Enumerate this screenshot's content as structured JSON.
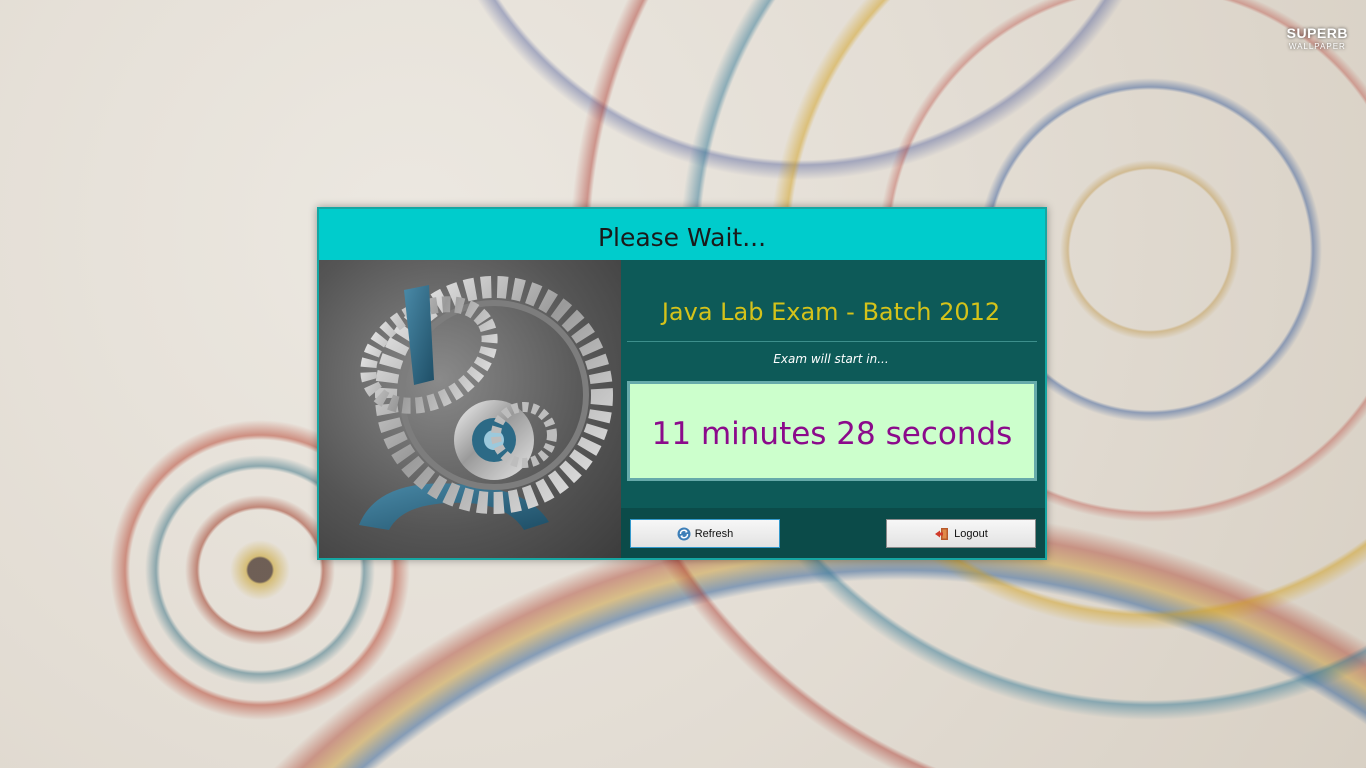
{
  "wallpaper": {
    "watermark_main": "SUPERB",
    "watermark_sub": "WALLPAPER"
  },
  "dialog": {
    "title": "Please Wait...",
    "exam_title": "Java Lab Exam - Batch 2012",
    "start_label": "Exam will start in...",
    "countdown": "11 minutes 28 seconds",
    "refresh_label": "Refresh",
    "logout_label": "Logout",
    "colors": {
      "header": "#00cccc",
      "body": "#0d5a58",
      "title_text": "#d4c21a",
      "countdown_bg": "#ccffcc",
      "countdown_text": "#8b0a8b"
    },
    "icons": {
      "refresh": "refresh-icon",
      "logout": "logout-door-icon",
      "image": "gears-icon"
    }
  }
}
